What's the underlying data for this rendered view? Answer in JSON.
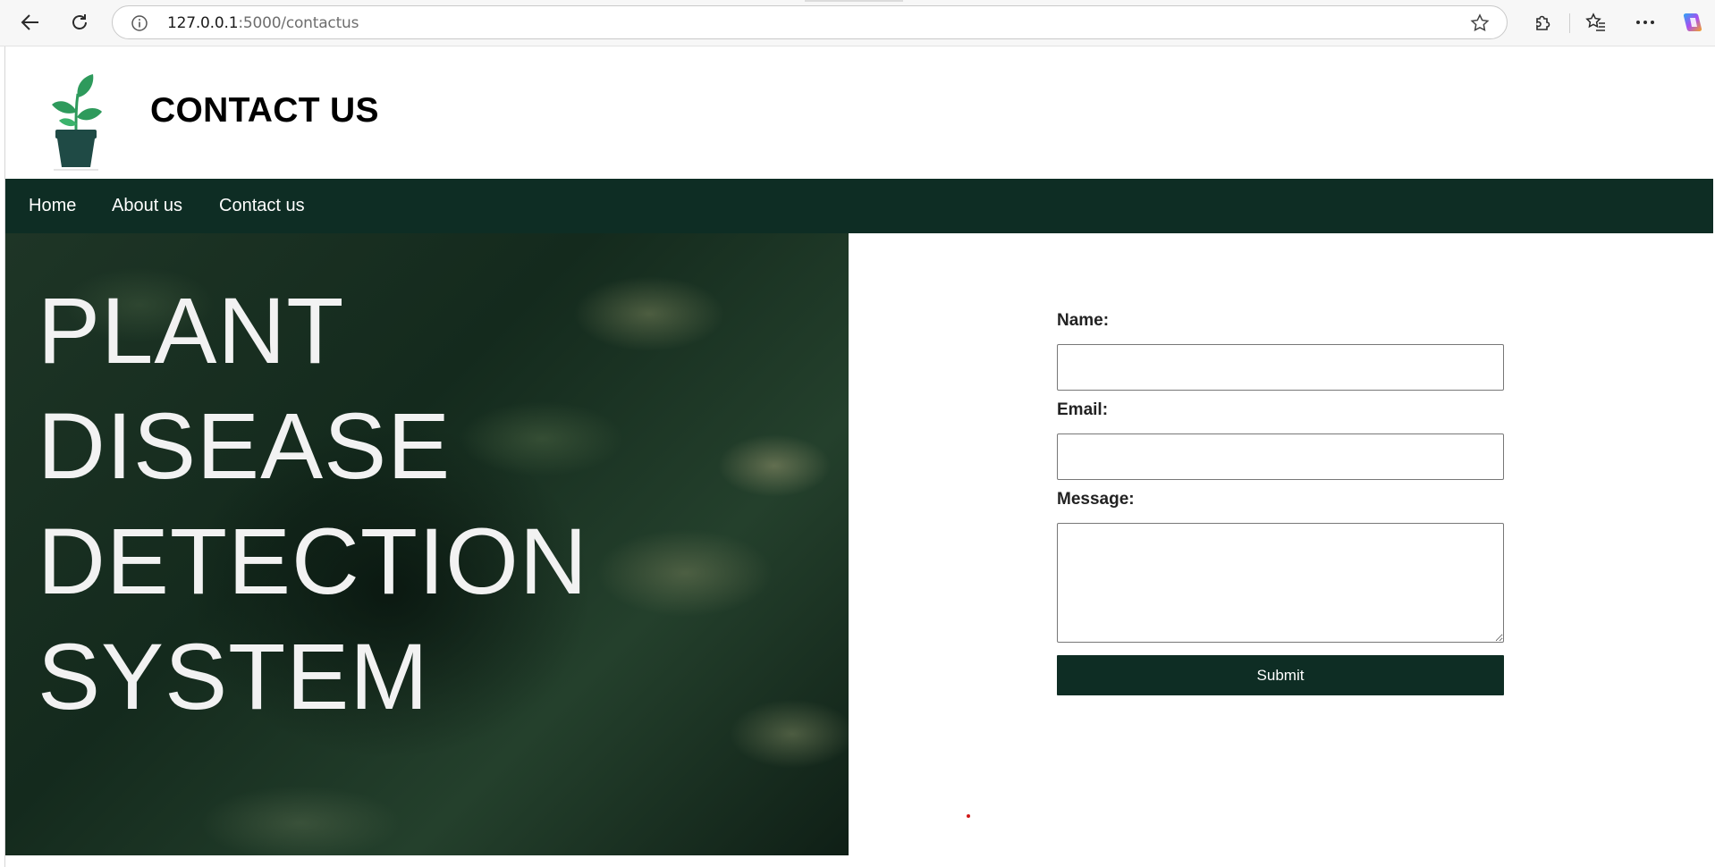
{
  "browser": {
    "url_host": "127.0.0.1",
    "url_rest": ":5000/contactus"
  },
  "header": {
    "title": "CONTACT US"
  },
  "nav": {
    "items": [
      "Home",
      "About us",
      "Contact us"
    ]
  },
  "hero": {
    "lines": [
      "PLANT",
      "DISEASE",
      "DETECTION",
      "SYSTEM"
    ]
  },
  "form": {
    "name_label": "Name:",
    "email_label": "Email:",
    "message_label": "Message:",
    "name_value": "",
    "email_value": "",
    "message_value": "",
    "submit_label": "Submit"
  },
  "colors": {
    "nav_bg": "#0e2d24",
    "button_bg": "#0e2d24",
    "logo_leaf": "#2e9a5c",
    "logo_pot": "#1f4a45"
  }
}
